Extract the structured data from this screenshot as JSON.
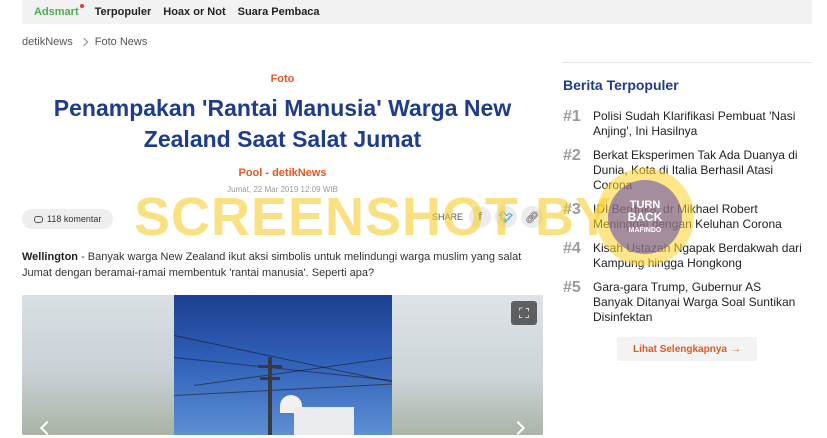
{
  "topnav": {
    "brand": "Adsmart",
    "links": [
      "Terpopuler",
      "Hoax or Not",
      "Suara Pembaca"
    ]
  },
  "breadcrumb": [
    "detikNews",
    "Foto News"
  ],
  "article": {
    "category": "Foto",
    "title": "Penampakan 'Rantai Manusia' Warga New Zealand Saat Salat Jumat",
    "author": "Pool - detikNews",
    "date": "Jumat, 22 Mar 2019 12:09 WIB",
    "comments": "118 komentar",
    "share_label": "SHARE",
    "lead_place": "Wellington",
    "lead_text": " - Banyak warga New Zealand ikut aksi simbolis untuk melindungi warga muslim yang salat Jumat dengan beramai-ramai membentuk 'rantai manusia'. Seperti apa?"
  },
  "sidebar": {
    "title": "Berita Terpopuler",
    "items": [
      {
        "num": "#1",
        "text": "Polisi Sudah Klarifikasi Pembuat 'Nasi Anjing', Ini Hasilnya"
      },
      {
        "num": "#2",
        "text": "Berkat Eksperimen Tak Ada Duanya di Dunia, Kota di Italia Berhasil Atasi Corona"
      },
      {
        "num": "#3",
        "text": "IDI Berduka, dr Mikhael Robert Meninggal dengan Keluhan Corona"
      },
      {
        "num": "#4",
        "text": "Kisah Ustazah Ngapak Berdakwah dari Kampung hingga Hongkong"
      },
      {
        "num": "#5",
        "text": "Gara-gara Trump, Gubernur AS Banyak Ditanyai Warga Soal Suntikan Disinfektan"
      }
    ],
    "more_label": "Lihat Selengkapnya"
  },
  "watermark": {
    "text": "SCREENSHOT BY",
    "seal_top": "TURN",
    "seal_mid": "BACK",
    "seal_bottom": "MAFINDO"
  },
  "icons": {
    "comment": "comment-icon",
    "facebook": "facebook-icon",
    "twitter": "twitter-icon",
    "link": "link-icon",
    "fullscreen": "fullscreen-icon"
  },
  "colors": {
    "accent": "#e8561f",
    "title": "#1e3c8c",
    "brand_green": "#4cae4c"
  }
}
